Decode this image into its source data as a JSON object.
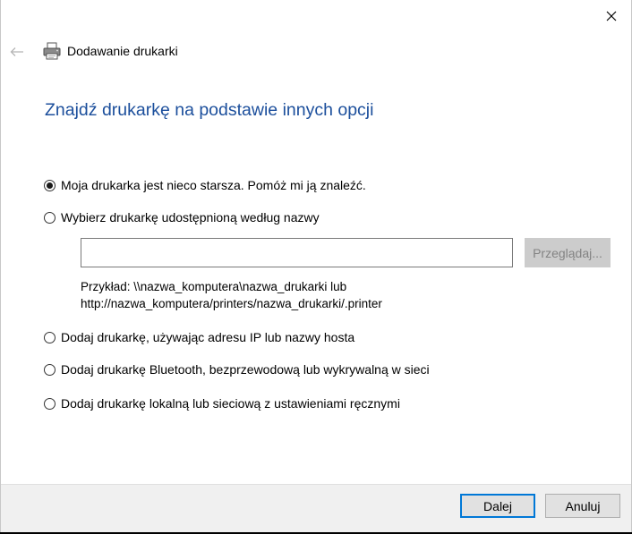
{
  "window": {
    "title": "Dodawanie drukarki",
    "close_icon": "close-icon",
    "back_icon": "back-arrow-icon",
    "app_icon": "printer-icon"
  },
  "page": {
    "heading": "Znajdź drukarkę na podstawie innych opcji"
  },
  "options": [
    {
      "label": "Moja drukarka jest nieco starsza. Pomóż mi ją znaleźć.",
      "selected": true
    },
    {
      "label": "Wybierz drukarkę udostępnioną według nazwy",
      "selected": false
    },
    {
      "label": "Dodaj drukarkę, używając adresu IP lub nazwy hosta",
      "selected": false
    },
    {
      "label": "Dodaj drukarkę Bluetooth, bezprzewodową lub wykrywalną w sieci",
      "selected": false
    },
    {
      "label": "Dodaj drukarkę lokalną lub sieciową z ustawieniami ręcznymi",
      "selected": false
    }
  ],
  "shared_printer": {
    "value": "",
    "browse_label": "Przeglądaj...",
    "example_line1": "Przykład: \\\\nazwa_komputera\\nazwa_drukarki lub",
    "example_line2": "http://nazwa_komputera/printers/nazwa_drukarki/.printer"
  },
  "footer": {
    "next_label": "Dalej",
    "cancel_label": "Anuluj"
  },
  "colors": {
    "heading": "#1c4f9c",
    "primary_border": "#0078d7",
    "footer_bg": "#f0f0f0"
  }
}
